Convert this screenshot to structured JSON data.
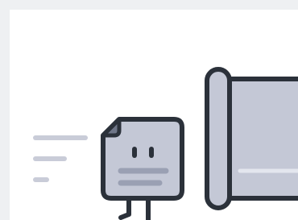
{
  "illustration": {
    "name": "document-character-next-to-scroll",
    "colors": {
      "page_background": "#eef0f2",
      "canvas": "#ffffff",
      "outline": "#2b313a",
      "document_fill": "#c4c8d6",
      "document_corner": "#6f7688",
      "mouth_stripes": "#9aa0b3",
      "scroll_fill": "#c4c8d6",
      "scroll_highlight": "#e3e6ee",
      "speed_lines": "#c9ccd8"
    }
  }
}
